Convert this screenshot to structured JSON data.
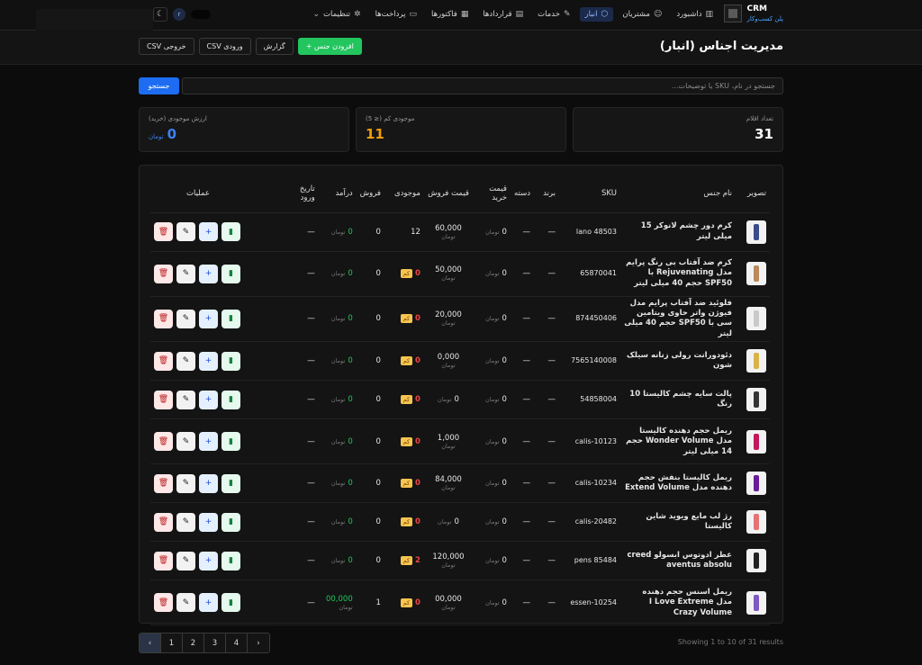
{
  "brand": {
    "title": "CRM",
    "subtitle": "پلن کسب‌وکار"
  },
  "nav": [
    {
      "label": "داشبورد",
      "icon": "chart-icon"
    },
    {
      "label": "مشتریان",
      "icon": "users-icon"
    },
    {
      "label": "انبار",
      "icon": "box-icon",
      "active": true
    },
    {
      "label": "خدمات",
      "icon": "wrench-icon"
    },
    {
      "label": "قراردادها",
      "icon": "file-icon"
    },
    {
      "label": "فاکتورها",
      "icon": "receipt-icon"
    },
    {
      "label": "پرداخت‌ها",
      "icon": "card-icon"
    },
    {
      "label": "تنظیمات",
      "icon": "gear-icon"
    }
  ],
  "user": {
    "avatar": "r"
  },
  "page": {
    "title": "مدیریت اجناس (انبار)",
    "add_button": "+ افزودن جنس",
    "report_button": "گزارش",
    "import_button": "CSV ورودی",
    "export_button": "CSV خروجی"
  },
  "search": {
    "placeholder": "جستجو در نام، SKU یا توضیحات...",
    "button": "جستجو"
  },
  "stats": {
    "items_label": "تعداد اقلام",
    "items_value": "31",
    "low_label": "موجودی کم (≤ 5)",
    "low_value": "11",
    "value_label": "ارزش موجودی (خرید)",
    "value_value": "0",
    "value_unit": "تومان"
  },
  "table": {
    "headers": {
      "image": "تصویر",
      "name": "نام جنس",
      "sku": "SKU",
      "brand": "برند",
      "category": "دسته",
      "buy_price": "قیمت خرید",
      "sell_price": "قیمت فروش",
      "stock": "موجودی",
      "sales": "فروش",
      "income": "درآمد",
      "entry_date": "تاریخ ورود",
      "operations": "عملیات"
    },
    "unit": "تومان",
    "low_badge": "کم",
    "rows": [
      {
        "name": "کرم دور چشم لانوکر 15 میلی لیتر",
        "sku": "lano 48503",
        "brand": "—",
        "category": "—",
        "buy": "0",
        "sell": "60,000",
        "stock": "12",
        "low": false,
        "sales": "0",
        "income": "0",
        "date": "—"
      },
      {
        "name": "کرم ضد آفتاب بی رنگ پرایم مدل Rejuvenating با SPF50 حجم 40 میلی لیتر",
        "sku": "65870041",
        "brand": "—",
        "category": "—",
        "buy": "0",
        "sell": "50,000",
        "stock": "0",
        "low": true,
        "sales": "0",
        "income": "0",
        "date": "—"
      },
      {
        "name": "فلوئید ضد آفتاب پرایم مدل فیوژن واتر حاوی ویتامین سی با SPF50 حجم 40 میلی لیتر",
        "sku": "874450406",
        "brand": "—",
        "category": "—",
        "buy": "0",
        "sell": "20,000",
        "stock": "0",
        "low": true,
        "sales": "0",
        "income": "0",
        "date": "—"
      },
      {
        "name": "دئودورانت رولی زنانه سیلک شون",
        "sku": "7565140008",
        "brand": "—",
        "category": "—",
        "buy": "0",
        "sell": "0,000",
        "stock": "0",
        "low": true,
        "sales": "0",
        "income": "0",
        "date": "—"
      },
      {
        "name": "پالت سایه چشم کالیستا 10 رنگ",
        "sku": "54858004",
        "brand": "—",
        "category": "—",
        "buy": "0",
        "sell": "0",
        "stock": "0",
        "low": true,
        "sales": "0",
        "income": "0",
        "date": "—"
      },
      {
        "name": "ریمل حجم دهنده کالیستا مدل Wonder Volume حجم 14 میلی لیتر",
        "sku": "calis-10123",
        "brand": "—",
        "category": "—",
        "buy": "0",
        "sell": "1,000",
        "stock": "0",
        "low": true,
        "sales": "0",
        "income": "0",
        "date": "—"
      },
      {
        "name": "ریمل کالیستا بنفش حجم دهنده مدل Extend Volume",
        "sku": "calis-10234",
        "brand": "—",
        "category": "—",
        "buy": "0",
        "sell": "84,000",
        "stock": "0",
        "low": true,
        "sales": "0",
        "income": "0",
        "date": "—"
      },
      {
        "name": "رژ لب مایع ویوید شاین کالیستا",
        "sku": "calis-20482",
        "brand": "—",
        "category": "—",
        "buy": "0",
        "sell": "0",
        "stock": "0",
        "low": true,
        "sales": "0",
        "income": "0",
        "date": "—"
      },
      {
        "name": "عطر ادوتوس ابسولو creed aventus absolu",
        "sku": "pens 85484",
        "brand": "—",
        "category": "—",
        "buy": "0",
        "sell": "120,000",
        "stock": "2",
        "low": true,
        "sales": "0",
        "income": "0",
        "date": "—"
      },
      {
        "name": "ریمل اسنس حجم دهنده مدل I Love Extreme Crazy Volume",
        "sku": "essen-10254",
        "brand": "—",
        "category": "—",
        "buy": "0",
        "sell": "00,000",
        "stock": "0",
        "low": true,
        "sales": "1",
        "income": "00,000",
        "date": "—"
      }
    ]
  },
  "pagination": {
    "showing": "Showing 1 to 10 of 31 results",
    "pages": [
      "1",
      "2",
      "3",
      "4"
    ]
  },
  "colors": {
    "accent": "#1d6cf2",
    "success": "#22c55e",
    "warning": "#f59e0b",
    "danger": "#ef4444"
  }
}
